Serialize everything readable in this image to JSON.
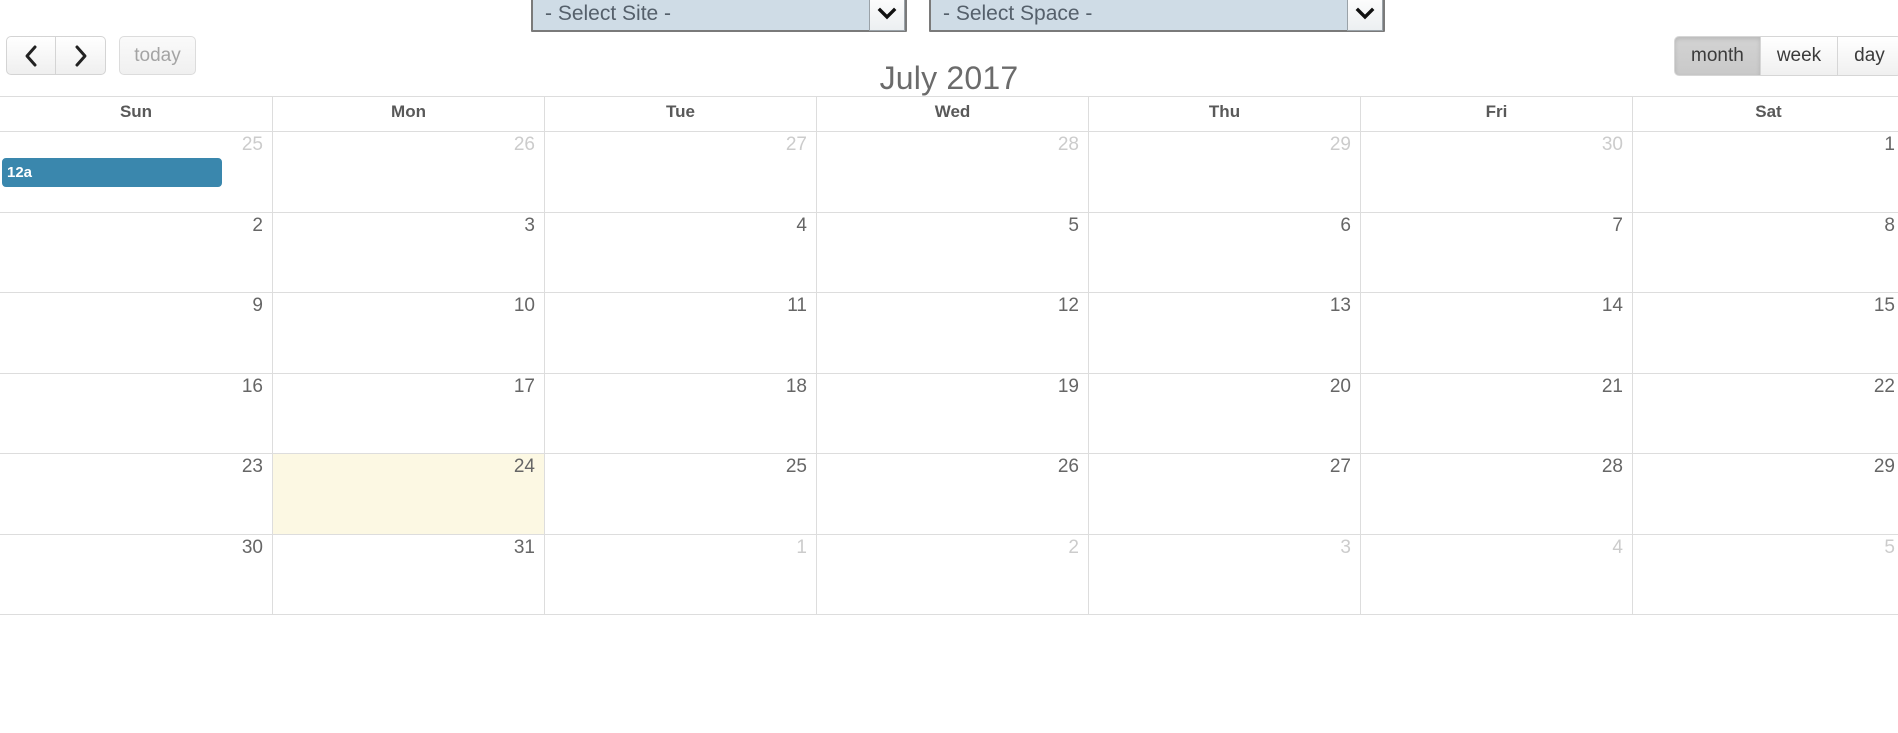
{
  "toolbar": {
    "prev_label": "‹",
    "next_label": "›",
    "today_label": "today",
    "title": "July 2017",
    "views": [
      {
        "label": "month",
        "active": true
      },
      {
        "label": "week",
        "active": false
      },
      {
        "label": "day",
        "active": false
      }
    ],
    "selects": [
      {
        "name": "site",
        "value": "- Select Site -"
      },
      {
        "name": "space",
        "value": "- Select Space -"
      }
    ]
  },
  "calendar": {
    "day_headers": [
      "Sun",
      "Mon",
      "Tue",
      "Wed",
      "Thu",
      "Fri",
      "Sat"
    ],
    "weeks": [
      {
        "days": [
          {
            "num": "25",
            "other": true,
            "today": false,
            "events": [
              {
                "time": "12a",
                "title": "",
                "color": "#3a87ad"
              }
            ]
          },
          {
            "num": "26",
            "other": true,
            "today": false,
            "events": []
          },
          {
            "num": "27",
            "other": true,
            "today": false,
            "events": []
          },
          {
            "num": "28",
            "other": true,
            "today": false,
            "events": []
          },
          {
            "num": "29",
            "other": true,
            "today": false,
            "events": []
          },
          {
            "num": "30",
            "other": true,
            "today": false,
            "events": []
          },
          {
            "num": "1",
            "other": false,
            "today": false,
            "events": []
          }
        ]
      },
      {
        "days": [
          {
            "num": "2",
            "other": false,
            "today": false,
            "events": []
          },
          {
            "num": "3",
            "other": false,
            "today": false,
            "events": []
          },
          {
            "num": "4",
            "other": false,
            "today": false,
            "events": []
          },
          {
            "num": "5",
            "other": false,
            "today": false,
            "events": []
          },
          {
            "num": "6",
            "other": false,
            "today": false,
            "events": []
          },
          {
            "num": "7",
            "other": false,
            "today": false,
            "events": []
          },
          {
            "num": "8",
            "other": false,
            "today": false,
            "events": []
          }
        ]
      },
      {
        "days": [
          {
            "num": "9",
            "other": false,
            "today": false,
            "events": []
          },
          {
            "num": "10",
            "other": false,
            "today": false,
            "events": []
          },
          {
            "num": "11",
            "other": false,
            "today": false,
            "events": []
          },
          {
            "num": "12",
            "other": false,
            "today": false,
            "events": []
          },
          {
            "num": "13",
            "other": false,
            "today": false,
            "events": []
          },
          {
            "num": "14",
            "other": false,
            "today": false,
            "events": []
          },
          {
            "num": "15",
            "other": false,
            "today": false,
            "events": []
          }
        ]
      },
      {
        "days": [
          {
            "num": "16",
            "other": false,
            "today": false,
            "events": []
          },
          {
            "num": "17",
            "other": false,
            "today": false,
            "events": []
          },
          {
            "num": "18",
            "other": false,
            "today": false,
            "events": []
          },
          {
            "num": "19",
            "other": false,
            "today": false,
            "events": []
          },
          {
            "num": "20",
            "other": false,
            "today": false,
            "events": []
          },
          {
            "num": "21",
            "other": false,
            "today": false,
            "events": []
          },
          {
            "num": "22",
            "other": false,
            "today": false,
            "events": []
          }
        ]
      },
      {
        "days": [
          {
            "num": "23",
            "other": false,
            "today": false,
            "events": []
          },
          {
            "num": "24",
            "other": false,
            "today": true,
            "events": []
          },
          {
            "num": "25",
            "other": false,
            "today": false,
            "events": []
          },
          {
            "num": "26",
            "other": false,
            "today": false,
            "events": []
          },
          {
            "num": "27",
            "other": false,
            "today": false,
            "events": []
          },
          {
            "num": "28",
            "other": false,
            "today": false,
            "events": []
          },
          {
            "num": "29",
            "other": false,
            "today": false,
            "events": []
          }
        ]
      },
      {
        "days": [
          {
            "num": "30",
            "other": false,
            "today": false,
            "events": []
          },
          {
            "num": "31",
            "other": false,
            "today": false,
            "events": []
          },
          {
            "num": "1",
            "other": true,
            "today": false,
            "events": []
          },
          {
            "num": "2",
            "other": true,
            "today": false,
            "events": []
          },
          {
            "num": "3",
            "other": true,
            "today": false,
            "events": []
          },
          {
            "num": "4",
            "other": true,
            "today": false,
            "events": []
          },
          {
            "num": "5",
            "other": true,
            "today": false,
            "events": []
          }
        ]
      }
    ]
  }
}
